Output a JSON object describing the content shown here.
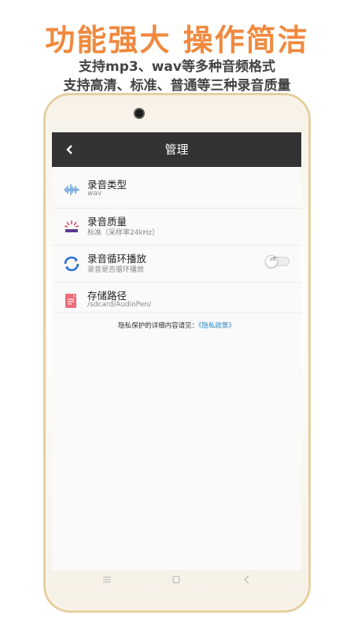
{
  "promo": {
    "headline": "功能强大 操作简洁",
    "line1": "支持mp3、wav等多种音频格式",
    "line2": "支持高清、标准、普通等三种录音质量"
  },
  "appbar": {
    "title": "管理",
    "back_icon": "back-chevron-icon"
  },
  "settings": [
    {
      "title": "录音类型",
      "desc": "wav",
      "icon": "waveform-icon"
    },
    {
      "title": "录音质量",
      "desc": "标准（采样率24kHz）",
      "icon": "quality-icon"
    },
    {
      "title": "录音循环播放",
      "desc": "录音是否循环播放",
      "icon": "loop-icon",
      "toggle": "off",
      "toggle_on": false
    },
    {
      "title": "存储路径",
      "desc": "/sdcard/AudioPen/",
      "icon": "folder-note-icon"
    }
  ],
  "privacy": {
    "text": "隐私保护的详细内容请见：",
    "link": "《隐私政策》"
  },
  "colors": {
    "accent": "#f0893e",
    "appbar": "#333335",
    "link": "#2a86c7"
  }
}
